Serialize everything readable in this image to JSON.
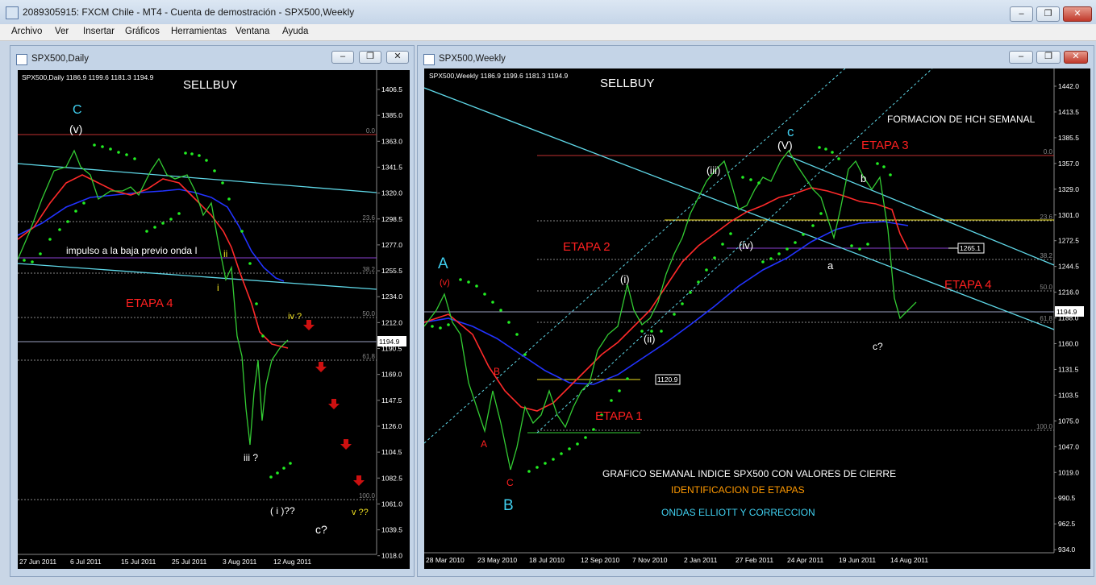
{
  "window": {
    "title": "2089305915: FXCM Chile - MT4 - Cuenta de demostración - SPX500,Weekly",
    "minimize_glyph": "–",
    "restore_glyph": "❐",
    "close_glyph": "✕"
  },
  "menu": [
    "Archivo",
    "Ver",
    "Insertar",
    "Gráficos",
    "Herramientas",
    "Ventana",
    "Ayuda"
  ],
  "daily": {
    "window_title": "SPX500,Daily",
    "header": "SPX500,Daily  1186.9 1199.6 1181.3 1194.9",
    "logo": "SELLBUY",
    "current_price": "1194.9",
    "price_axis": [
      "1406.5",
      "1385.0",
      "1363.0",
      "1341.5",
      "1320.0",
      "1298.5",
      "1277.0",
      "1255.5",
      "1234.0",
      "1212.0",
      "1190.5",
      "1169.0",
      "1147.5",
      "1126.0",
      "1104.5",
      "1082.5",
      "1061.0",
      "1039.5",
      "1018.0"
    ],
    "date_axis": [
      "27 Jun 2011",
      "6 Jul 2011",
      "15 Jul 2011",
      "25 Jul 2011",
      "3 Aug 2011",
      "12 Aug 2011"
    ],
    "fib_levels": [
      "0.0",
      "23.6",
      "38.2",
      "50.0",
      "61.8",
      "100.0"
    ],
    "labels": {
      "wave_C": "C",
      "wave_v": "(v)",
      "impulse_note": "impulso a la baja previo onda I",
      "etapa4": "ETAPA 4",
      "wave_ii": "ii",
      "wave_i": "i",
      "wave_iv": "iv ?",
      "wave_iii": "iii ?",
      "wave_I": "( i )??",
      "wave_vq": "v ??",
      "wave_c": "c?"
    }
  },
  "weekly": {
    "window_title": "SPX500,Weekly",
    "header": "SPX500,Weekly  1186.9 1199.6 1181.3 1194.9",
    "logo": "SELLBUY",
    "current_price": "1194.9",
    "box_1265": "1265.1",
    "box_1120": "1120.9",
    "price_axis": [
      "1442.0",
      "1413.5",
      "1385.5",
      "1357.0",
      "1329.0",
      "1301.0",
      "1272.5",
      "1244.5",
      "1216.0",
      "1188.0",
      "1160.0",
      "1131.5",
      "1103.5",
      "1075.0",
      "1047.0",
      "1019.0",
      "990.5",
      "962.5",
      "934.0"
    ],
    "date_axis": [
      "28 Mar 2010",
      "23 May 2010",
      "18 Jul 2010",
      "12 Sep 2010",
      "7 Nov 2010",
      "2 Jan 2011",
      "27 Feb 2011",
      "24 Apr 2011",
      "19 Jun 2011",
      "14 Aug 2011"
    ],
    "fib_levels": [
      "0.0",
      "23.6",
      "38.2",
      "50.0",
      "61.8",
      "100.0"
    ],
    "labels": {
      "hch": "FORMACION DE HCH SEMANAL",
      "etapa3": "ETAPA 3",
      "etapa2": "ETAPA 2",
      "etapa4": "ETAPA 4",
      "etapa1": "ETAPA 1",
      "wave_c_top": "c",
      "wave_V": "(V)",
      "wave_iii": "(iii)",
      "wave_iv": "(iv)",
      "wave_i": "(i)",
      "wave_ii": "(ii)",
      "wave_a": "a",
      "wave_b": "b",
      "wave_cq": "c?",
      "wave_A": "A",
      "wave_v_small": "(v)",
      "wave_B_red": "B",
      "wave_A_red": "A",
      "wave_C_red": "C",
      "wave_B_big": "B",
      "caption1": "GRAFICO SEMANAL  INDICE SPX500 CON VALORES DE CIERRE",
      "caption2": "IDENTIFICACION DE ETAPAS",
      "caption3": "ONDAS ELLIOTT Y CORRECCION"
    }
  },
  "colors": {
    "price_line": "#33cc33",
    "red_ma": "#ff2a2a",
    "blue_ma": "#2233ff",
    "sar_dots": "#22ee22",
    "channel": "#5fd8e8",
    "label_red": "#ff2020",
    "label_cyan": "#40d0f0",
    "label_yellow": "#f0e020",
    "label_orange": "#ff9900"
  }
}
